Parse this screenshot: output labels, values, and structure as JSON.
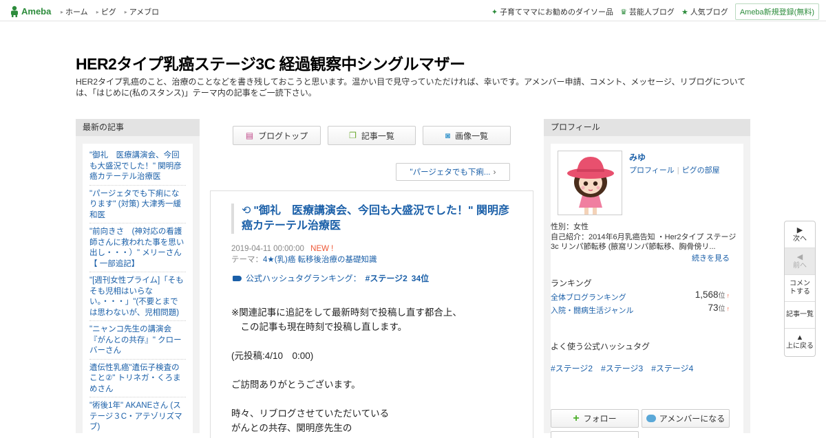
{
  "topbar": {
    "logo": "Ameba",
    "nav": [
      "ホーム",
      "ピグ",
      "アメブロ"
    ],
    "right_links": [
      {
        "icon": "sparkle-icon",
        "label": "子育てママにお勧めのダイソー品"
      },
      {
        "icon": "crown-icon",
        "label": "芸能人ブログ"
      },
      {
        "icon": "star-icon",
        "label": "人気ブログ"
      }
    ],
    "signup": "Ameba新規登録(無料)"
  },
  "blog": {
    "title": "HER2タイプ乳癌ステージ3C 経過観察中シングルマザー",
    "description": "HER2タイプ乳癌のこと、治療のことなどを書き残しておこうと思います。温かい目で見守っていただければ、幸いです。アメンバー申請、コメント、メッセージ、リブログについては、「はじめに(私のスタンス)」テーマ内の記事をご一読下さい。"
  },
  "left_sidebar": {
    "heading": "最新の記事",
    "items": [
      "\"御礼　医療講演会、今回も大盛況でした！\" 関明彦 癌カテーテル治療医",
      "\"パージェタでも下痢になります\" (対策) 大津秀一緩和医",
      "\"前向きさ　(神対応の看護師さんに救われた事を思い出し・・・）\" メリーさん【 一部追記】",
      "\"[週刊女性プライム]「そもそも児相はいらない。・・・」\"(不要とまでは思わないが、児相問題)",
      "\"ニャンコ先生の講演会『がんとの共存』\" クローバーさん",
      "遺伝性乳癌\"遺伝子検査のこと②\" トリネガ・くろまめさん",
      "\"術後1年\" AKANEさん (ステージ３C・アテゾリズマブ)"
    ]
  },
  "center": {
    "tabs": [
      {
        "icon": "list-icon",
        "label": "ブログトップ"
      },
      {
        "icon": "documents-icon",
        "label": "記事一覧"
      },
      {
        "icon": "camera-icon",
        "label": "画像一覧"
      }
    ],
    "next_article": "\"パージェタでも下痢...",
    "article": {
      "title": "\"御礼　医療講演会、今回も大盛況でした！\" 関明彦 癌カテーテル治療医",
      "date": "2019-04-11 00:00:00",
      "new_badge": "NEW !",
      "theme_label": "テーマ：",
      "theme": "4★(乳)癌 転移後治療の基礎知識",
      "ranking_label": "公式ハッシュタグランキング：",
      "ranking_tag": "#ステージ2",
      "ranking_rank": "34位",
      "body": "※関連記事に追記をして最新時刻で投稿し直す都合上、\n　この記事も現在時刻で投稿し直します。\n\n(元投稿:4/10　0:00)\n\nご訪問ありがとうございます。\n\n時々、リブログさせていただいている\nがんとの共存、関明彦先生の"
    }
  },
  "right_sidebar": {
    "heading": "プロフィール",
    "name": "みゆ",
    "links": [
      "プロフィール",
      "ピグの部屋"
    ],
    "gender": "性別：女性",
    "intro": "自己紹介：2014年6月乳癌告知 ・Her2タイプ ステージ3c リンパ節転移 (腋窩リンパ節転移、胸骨傍リ...",
    "read_more": "続きを見る",
    "ranking_heading": "ランキング",
    "rankings": [
      {
        "label": "全体ブログランキング",
        "value": "1,568",
        "unit": "位",
        "arrow": "↑"
      },
      {
        "label": "入院・闘病生活ジャンル",
        "value": "73",
        "unit": "位",
        "arrow": "↑"
      }
    ],
    "hashtag_heading": "よく使う公式ハッシュタグ",
    "hashtags": [
      "#ステージ2",
      "#ステージ3",
      "#ステージ4"
    ],
    "follow": "フォロー",
    "member": "アメンバーになる"
  },
  "floatnav": {
    "next": "次へ",
    "prev": "前へ",
    "comment": "コメントする",
    "list": "記事一覧",
    "top": "上に戻る"
  }
}
